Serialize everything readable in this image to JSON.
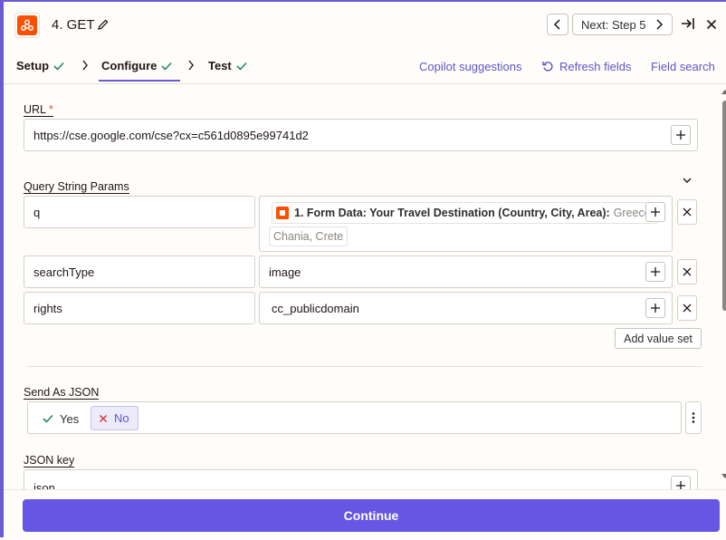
{
  "header": {
    "step_title": "4. GET",
    "next_label": "Next: Step 5"
  },
  "tabs": [
    {
      "label": "Setup"
    },
    {
      "label": "Configure"
    },
    {
      "label": "Test"
    }
  ],
  "tab_links": {
    "copilot": "Copilot suggestions",
    "refresh": "Refresh fields",
    "field_search": "Field search"
  },
  "url_field": {
    "label": "URL",
    "required_mark": "*",
    "value": "https://cse.google.com/cse?cx=c561d0895e99741d2"
  },
  "query_params": {
    "label": "Query String Params",
    "rows": [
      {
        "key": "q",
        "pill_label": "1. Form Data: Your Travel Destination (Country, City, Area):",
        "pill_value": "Greece,",
        "pill_value_cont": "Chania, Crete"
      },
      {
        "key": "searchType",
        "value": "image"
      },
      {
        "key": "rights",
        "value": "cc_publicdomain"
      }
    ],
    "add_value_set": "Add value set"
  },
  "send_as_json": {
    "label": "Send As JSON",
    "yes": "Yes",
    "no": "No",
    "selected": "No"
  },
  "json_key": {
    "label": "JSON key",
    "value": "json"
  },
  "footer": {
    "continue": "Continue"
  },
  "colors": {
    "accent": "#6557e3",
    "brand_orange": "#ff4f00",
    "success_check": "#1f8a5e"
  }
}
